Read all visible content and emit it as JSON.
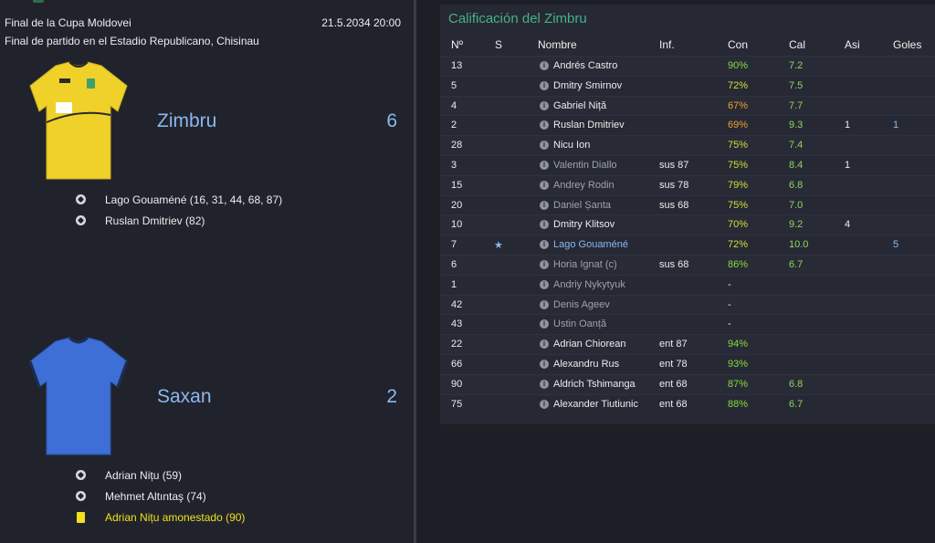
{
  "match": {
    "competition": "Final de la Cupa Moldovei",
    "datetime": "21.5.2034 20:00",
    "venue": "Final de partido en el Estadio Republicano, Chisinau"
  },
  "home": {
    "name": "Zimbru",
    "score": "6",
    "shirt_color": "#efd12a",
    "events": [
      {
        "type": "goal",
        "text": "Lago Gouaméné (16, 31, 44, 68, 87)"
      },
      {
        "type": "goal",
        "text": "Ruslan Dmitriev (82)"
      }
    ]
  },
  "away": {
    "name": "Saxan",
    "score": "2",
    "shirt_color": "#3d6fd6",
    "events": [
      {
        "type": "goal",
        "text": "Adrian Nițu (59)"
      },
      {
        "type": "goal",
        "text": "Mehmet Altıntaş (74)"
      },
      {
        "type": "yellow-card",
        "text": "Adrian Nițu amonestado (90)"
      }
    ]
  },
  "ratings": {
    "title": "Calificación del Zimbru",
    "headers": {
      "no": "Nº",
      "s": "S",
      "name": "Nombre",
      "inf": "Inf.",
      "con": "Con",
      "cal": "Cal",
      "asi": "Asi",
      "goles": "Goles"
    },
    "rows": [
      {
        "no": "13",
        "s": "",
        "name": "Andrés Castro",
        "inf": "",
        "con": "90%",
        "cal": "7.2",
        "asi": "",
        "goles": "",
        "con_color": "green",
        "name_style": ""
      },
      {
        "no": "5",
        "s": "",
        "name": "Dmitry Smirnov",
        "inf": "",
        "con": "72%",
        "cal": "7.5",
        "asi": "",
        "goles": "",
        "con_color": "yellow",
        "name_style": ""
      },
      {
        "no": "4",
        "s": "",
        "name": "Gabriel Niță",
        "inf": "",
        "con": "67%",
        "cal": "7.7",
        "asi": "",
        "goles": "",
        "con_color": "orange",
        "name_style": ""
      },
      {
        "no": "2",
        "s": "",
        "name": "Ruslan Dmitriev",
        "inf": "",
        "con": "69%",
        "cal": "9.3",
        "asi": "1",
        "goles": "1",
        "con_color": "orange",
        "name_style": ""
      },
      {
        "no": "28",
        "s": "",
        "name": "Nicu Ion",
        "inf": "",
        "con": "75%",
        "cal": "7.4",
        "asi": "",
        "goles": "",
        "con_color": "yellow",
        "name_style": ""
      },
      {
        "no": "3",
        "s": "",
        "name": "Valentin Diallo",
        "inf": "sus 87",
        "con": "75%",
        "cal": "8.4",
        "asi": "1",
        "goles": "",
        "con_color": "yellow",
        "name_style": "dim"
      },
      {
        "no": "15",
        "s": "",
        "name": "Andrey Rodin",
        "inf": "sus 78",
        "con": "79%",
        "cal": "6.8",
        "asi": "",
        "goles": "",
        "con_color": "yellow",
        "name_style": "dim"
      },
      {
        "no": "20",
        "s": "",
        "name": "Daniel Șanta",
        "inf": "sus 68",
        "con": "75%",
        "cal": "7.0",
        "asi": "",
        "goles": "",
        "con_color": "yellow",
        "name_style": "dim"
      },
      {
        "no": "10",
        "s": "",
        "name": "Dmitry Klitsov",
        "inf": "",
        "con": "70%",
        "cal": "9.2",
        "asi": "4",
        "goles": "",
        "con_color": "yellow",
        "name_style": ""
      },
      {
        "no": "7",
        "s": "★",
        "name": "Lago Gouaméné",
        "inf": "",
        "con": "72%",
        "cal": "10.0",
        "asi": "",
        "goles": "5",
        "con_color": "yellow",
        "name_style": "hl"
      },
      {
        "no": "6",
        "s": "",
        "name": "Horia Ignat (c)",
        "inf": "sus 68",
        "con": "86%",
        "cal": "6.7",
        "asi": "",
        "goles": "",
        "con_color": "green",
        "name_style": "dim"
      },
      {
        "no": "1",
        "s": "",
        "name": "Andriy Nykytyuk",
        "inf": "",
        "con": "-",
        "cal": "",
        "asi": "",
        "goles": "",
        "con_color": "",
        "name_style": "dim"
      },
      {
        "no": "42",
        "s": "",
        "name": "Denis Ageev",
        "inf": "",
        "con": "-",
        "cal": "",
        "asi": "",
        "goles": "",
        "con_color": "",
        "name_style": "dim"
      },
      {
        "no": "43",
        "s": "",
        "name": "Ustin Oanță",
        "inf": "",
        "con": "-",
        "cal": "",
        "asi": "",
        "goles": "",
        "con_color": "",
        "name_style": "dim"
      },
      {
        "no": "22",
        "s": "",
        "name": "Adrian Chiorean",
        "inf": "ent 87",
        "con": "94%",
        "cal": "",
        "asi": "",
        "goles": "",
        "con_color": "green",
        "name_style": ""
      },
      {
        "no": "66",
        "s": "",
        "name": "Alexandru Rus",
        "inf": "ent 78",
        "con": "93%",
        "cal": "",
        "asi": "",
        "goles": "",
        "con_color": "green",
        "name_style": ""
      },
      {
        "no": "90",
        "s": "",
        "name": "Aldrich Tshimanga",
        "inf": "ent 68",
        "con": "87%",
        "cal": "6.8",
        "asi": "",
        "goles": "",
        "con_color": "green",
        "name_style": ""
      },
      {
        "no": "75",
        "s": "",
        "name": "Alexander Tiutiunic",
        "inf": "ent 68",
        "con": "88%",
        "cal": "6.7",
        "asi": "",
        "goles": "",
        "con_color": "green",
        "name_style": ""
      }
    ]
  }
}
